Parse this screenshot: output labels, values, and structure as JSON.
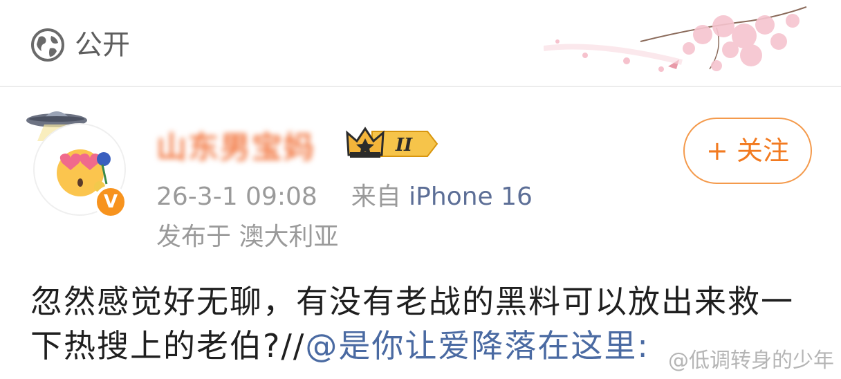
{
  "header": {
    "visibility_icon": "globe-icon",
    "visibility_label": "公开",
    "decoration": "cherry-blossom-decoration"
  },
  "author": {
    "name": "山东男宝妈",
    "avatar_icon": "heart-eyes-emoji-avatar",
    "pendant_icon": "ufo-icon",
    "verified_icon": "orange-v-verified-badge",
    "verified_glyph": "V",
    "level_badge_icon": "crown-level-badge",
    "level_badge_text": "II",
    "follow_label": "+ 关注"
  },
  "meta": {
    "timestamp": "26-3-1 09:08",
    "source_prefix": "来自",
    "device": "iPhone 16",
    "location": "发布于 澳大利亚"
  },
  "post": {
    "text": "忽然感觉好无聊，有没有老战的黑料可以放出来救一下热搜上的老伯?//",
    "mention": "@是你让爱降落在这里:"
  },
  "watermark": "@低调转身的少年",
  "colors": {
    "accent_orange": "#f27a20",
    "link_blue": "#4a6aa2",
    "meta_gray": "#9a9a9a"
  }
}
